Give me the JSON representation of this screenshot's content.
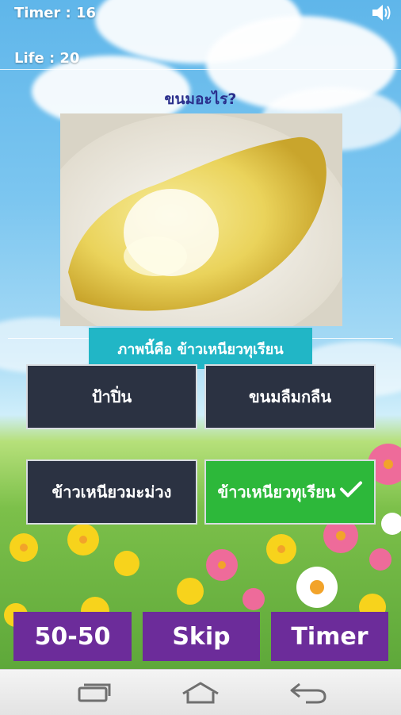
{
  "hud": {
    "timer_text": "Timer  : 16",
    "life_text": "Life : 20"
  },
  "question": "ขนมอะไร?",
  "answer_banner": "ภาพนี้คือ ข้าวเหนียวทุเรียน",
  "answers": [
    {
      "label": "ป้าปิ่น"
    },
    {
      "label": "ขนมลืมกลืน"
    },
    {
      "label": "ข้าวเหนียวมะม่วง"
    },
    {
      "label": "ข้าวเหนียวทุเรียน",
      "correct": true
    }
  ],
  "lifelines": {
    "fifty_fifty": "50-50",
    "skip": "Skip",
    "timer": "Timer"
  },
  "icons": {
    "sound": "speaker-icon",
    "check": "check-icon",
    "nav_recents": "recent-apps-icon",
    "nav_home": "home-icon",
    "nav_back": "back-icon"
  },
  "colors": {
    "answer_bg": "#2b3242",
    "correct_bg": "#2db83a",
    "banner_bg": "#21b6c6",
    "lifeline_bg": "#6c2c9a",
    "question_text": "#2a2f8c"
  }
}
